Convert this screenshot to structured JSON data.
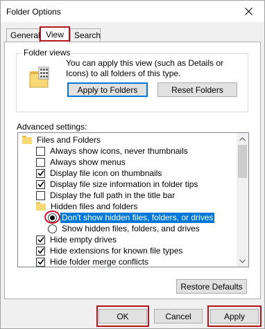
{
  "window": {
    "title": "Folder Options"
  },
  "tabs": [
    {
      "label": "General",
      "active": false
    },
    {
      "label": "View",
      "active": true,
      "highlighted": true
    },
    {
      "label": "Search",
      "active": false
    }
  ],
  "folder_views": {
    "label": "Folder views",
    "description": "You can apply this view (such as Details or Icons) to all folders of this type.",
    "apply_button": "Apply to Folders",
    "reset_button": "Reset Folders"
  },
  "advanced": {
    "label": "Advanced settings:",
    "items": [
      {
        "kind": "folder",
        "label": "Files and Folders"
      },
      {
        "kind": "checkbox",
        "label": "Always show icons, never thumbnails",
        "checked": false
      },
      {
        "kind": "checkbox",
        "label": "Always show menus",
        "checked": false
      },
      {
        "kind": "checkbox",
        "label": "Display file icon on thumbnails",
        "checked": true
      },
      {
        "kind": "checkbox",
        "label": "Display file size information in folder tips",
        "checked": true
      },
      {
        "kind": "checkbox",
        "label": "Display the full path in the title bar",
        "checked": false
      },
      {
        "kind": "folder",
        "label": "Hidden files and folders"
      },
      {
        "kind": "radio",
        "label": "Don't show hidden files, folders, or drives",
        "checked": true,
        "selected": true,
        "highlighted": true
      },
      {
        "kind": "radio",
        "label": "Show hidden files, folders, and drives",
        "checked": false
      },
      {
        "kind": "checkbox",
        "label": "Hide empty drives",
        "checked": true
      },
      {
        "kind": "checkbox",
        "label": "Hide extensions for known file types",
        "checked": true
      },
      {
        "kind": "checkbox",
        "label": "Hide folder merge conflicts",
        "checked": true
      }
    ],
    "restore_button": "Restore Defaults"
  },
  "footer": {
    "ok": "OK",
    "cancel": "Cancel",
    "apply": "Apply"
  },
  "colors": {
    "highlight_outline": "#b4141a",
    "selection": "#0078d7",
    "folder": "#f8d775"
  }
}
